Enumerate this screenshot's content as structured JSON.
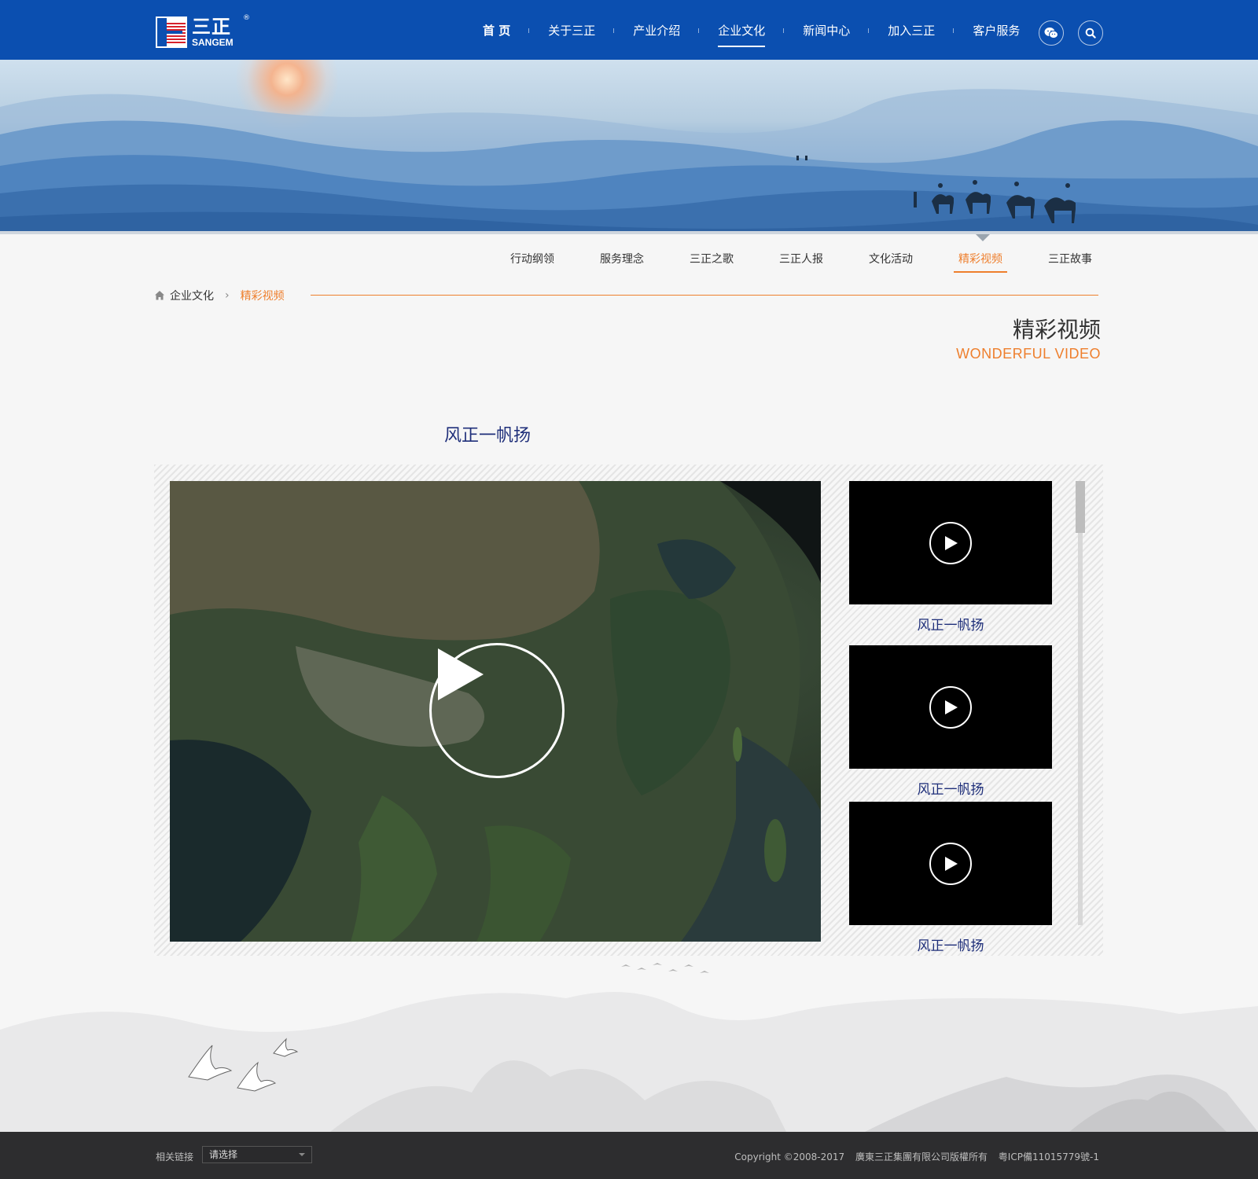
{
  "header": {
    "logo": {
      "cn": "三正",
      "en": "SANGEM",
      "reg": "®"
    },
    "nav": [
      {
        "label": "首 页"
      },
      {
        "label": "关于三正"
      },
      {
        "label": "产业介绍"
      },
      {
        "label": "企业文化"
      },
      {
        "label": "新闻中心"
      },
      {
        "label": "加入三正"
      },
      {
        "label": "客户服务"
      }
    ],
    "active_nav": "企业文化"
  },
  "subnav": {
    "items": [
      {
        "label": "行动纲领"
      },
      {
        "label": "服务理念"
      },
      {
        "label": "三正之歌"
      },
      {
        "label": "三正人报"
      },
      {
        "label": "文化活动"
      },
      {
        "label": "精彩视频"
      },
      {
        "label": "三正故事"
      }
    ],
    "active": "精彩视频"
  },
  "breadcrumb": {
    "parent": "企业文化",
    "current": "精彩视频"
  },
  "page_title": {
    "cn": "精彩视频",
    "en": "WONDERFUL VIDEO"
  },
  "video": {
    "heading": "风正一帆扬",
    "thumbnails": [
      {
        "title": "风正一帆扬"
      },
      {
        "title": "风正一帆扬"
      },
      {
        "title": "风正一帆扬"
      }
    ]
  },
  "footer": {
    "links_label": "相关链接",
    "select_value": "请选择",
    "copyright": "Copyright ©2008-2017",
    "company": "廣東三正集團有限公司版權所有",
    "icp": "粤ICP備11015779號-1"
  },
  "colors": {
    "brand_blue": "#0b4fb0",
    "accent_orange": "#ee7f2d",
    "title_navy": "#1f2f7a",
    "footer_bg": "#2d2d2f"
  }
}
